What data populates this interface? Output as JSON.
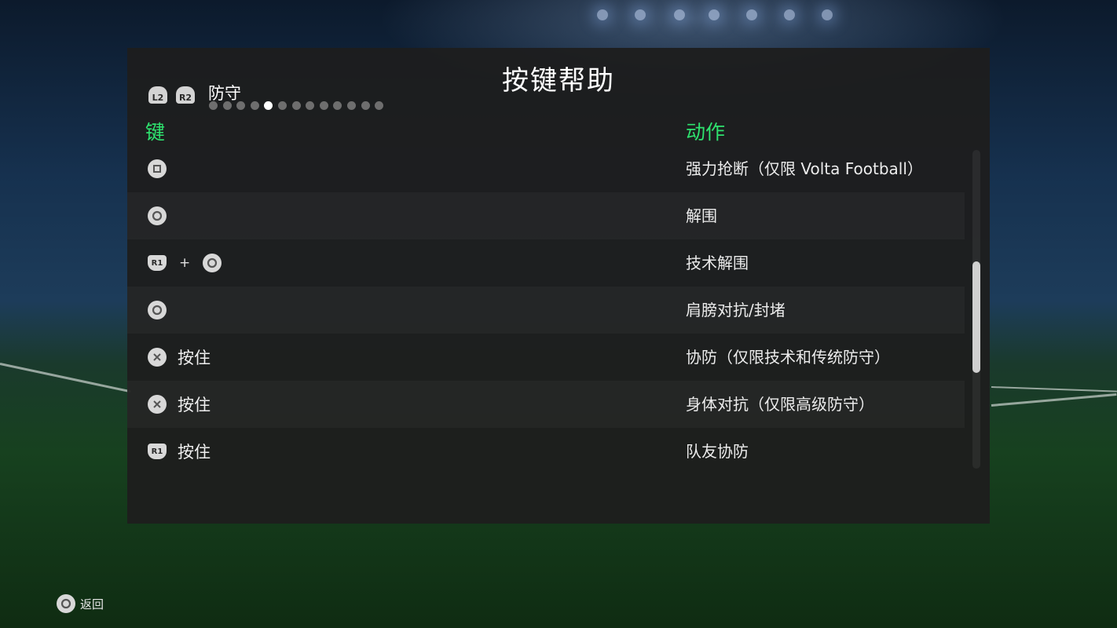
{
  "title": "按键帮助",
  "category": {
    "prev_button": "L2",
    "next_button": "R2",
    "label": "防守",
    "page_count": 13,
    "active_page": 5
  },
  "columns": {
    "key": "键",
    "action": "动作"
  },
  "rows": [
    {
      "keys": [
        "square-button-icon"
      ],
      "hold": "",
      "action": "强力抢断（仅限 Volta Football）"
    },
    {
      "keys": [
        "circle-button-icon"
      ],
      "hold": "",
      "action": "解围"
    },
    {
      "keys": [
        "r1-button-icon",
        "circle-button-icon"
      ],
      "plus": "+",
      "hold": "",
      "action": "技术解围"
    },
    {
      "keys": [
        "circle-button-icon"
      ],
      "hold": "",
      "action": "肩膀对抗/封堵"
    },
    {
      "keys": [
        "cross-button-icon"
      ],
      "hold": "按住",
      "action": "协防（仅限技术和传统防守）"
    },
    {
      "keys": [
        "cross-button-icon"
      ],
      "hold": "按住",
      "action": "身体对抗（仅限高级防守）"
    },
    {
      "keys": [
        "r1-button-icon"
      ],
      "hold": "按住",
      "action": "队友协防"
    }
  ],
  "r1_label": "R1",
  "scroll_position": 0.35,
  "footer": {
    "back_label": "返回",
    "back_icon": "circle-button-icon"
  },
  "colors": {
    "header_green": "#2ee26e",
    "panel": "#1e1e1e"
  }
}
